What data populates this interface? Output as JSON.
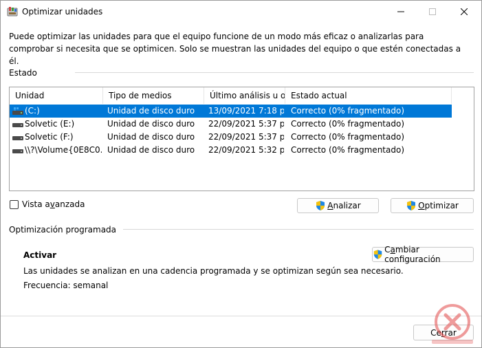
{
  "window": {
    "title": "Optimizar unidades"
  },
  "description": "Puede optimizar las unidades para que el equipo funcione de un modo más eficaz o analizarlas para comprobar si necesita que se optimicen. Solo se muestran las unidades del equipo o que estén conectadas a él.",
  "estado": {
    "label": "Estado",
    "columns": [
      "Unidad",
      "Tipo de medios",
      "Último análisis u o...",
      "Estado actual"
    ],
    "rows": [
      {
        "unidad": "(C:)",
        "tipo": "Unidad de disco duro",
        "ultimo": "13/09/2021 7:18 p. ...",
        "estado": "Correcto (0% fragmentado)",
        "selected": true
      },
      {
        "unidad": "Solvetic (E:)",
        "tipo": "Unidad de disco duro",
        "ultimo": "22/09/2021 5:37 p. ...",
        "estado": "Correcto (0% fragmentado)",
        "selected": false
      },
      {
        "unidad": "Solvetic (F:)",
        "tipo": "Unidad de disco duro",
        "ultimo": "22/09/2021 5:37 p. ...",
        "estado": "Correcto (0% fragmentado)",
        "selected": false
      },
      {
        "unidad": "\\\\?\\Volume{0E8C0...",
        "tipo": "Unidad de disco duro",
        "ultimo": "22/09/2021 5:32 p. ...",
        "estado": "Correcto (0% fragmentado)",
        "selected": false
      }
    ]
  },
  "vista_avanzada": {
    "label_pre": "Vista a",
    "label_ul": "v",
    "label_post": "anzada",
    "checked": false
  },
  "buttons": {
    "analizar": {
      "ul": "A",
      "rest": "nalizar"
    },
    "optimizar": {
      "ul": "O",
      "rest": "ptimizar"
    },
    "cambiar": {
      "pre": "C",
      "ul": "a",
      "rest": "mbiar configuración"
    },
    "cerrar": {
      "pre": "Ce",
      "ul": "r",
      "rest": "rar"
    }
  },
  "programada": {
    "label": "Optimización programada",
    "status": "Activar",
    "info": "Las unidades se analizan en una cadencia programada y se optimizan según sea necesario.",
    "frecuencia": "Frecuencia: semanal"
  },
  "colors": {
    "selection": "#0078d7",
    "accent": "#0078d7"
  },
  "icons": [
    "app-icon",
    "minimize-icon",
    "maximize-icon",
    "close-icon",
    "system-drive-icon",
    "hard-drive-icon",
    "uac-shield-icon",
    "watermark-logo"
  ]
}
